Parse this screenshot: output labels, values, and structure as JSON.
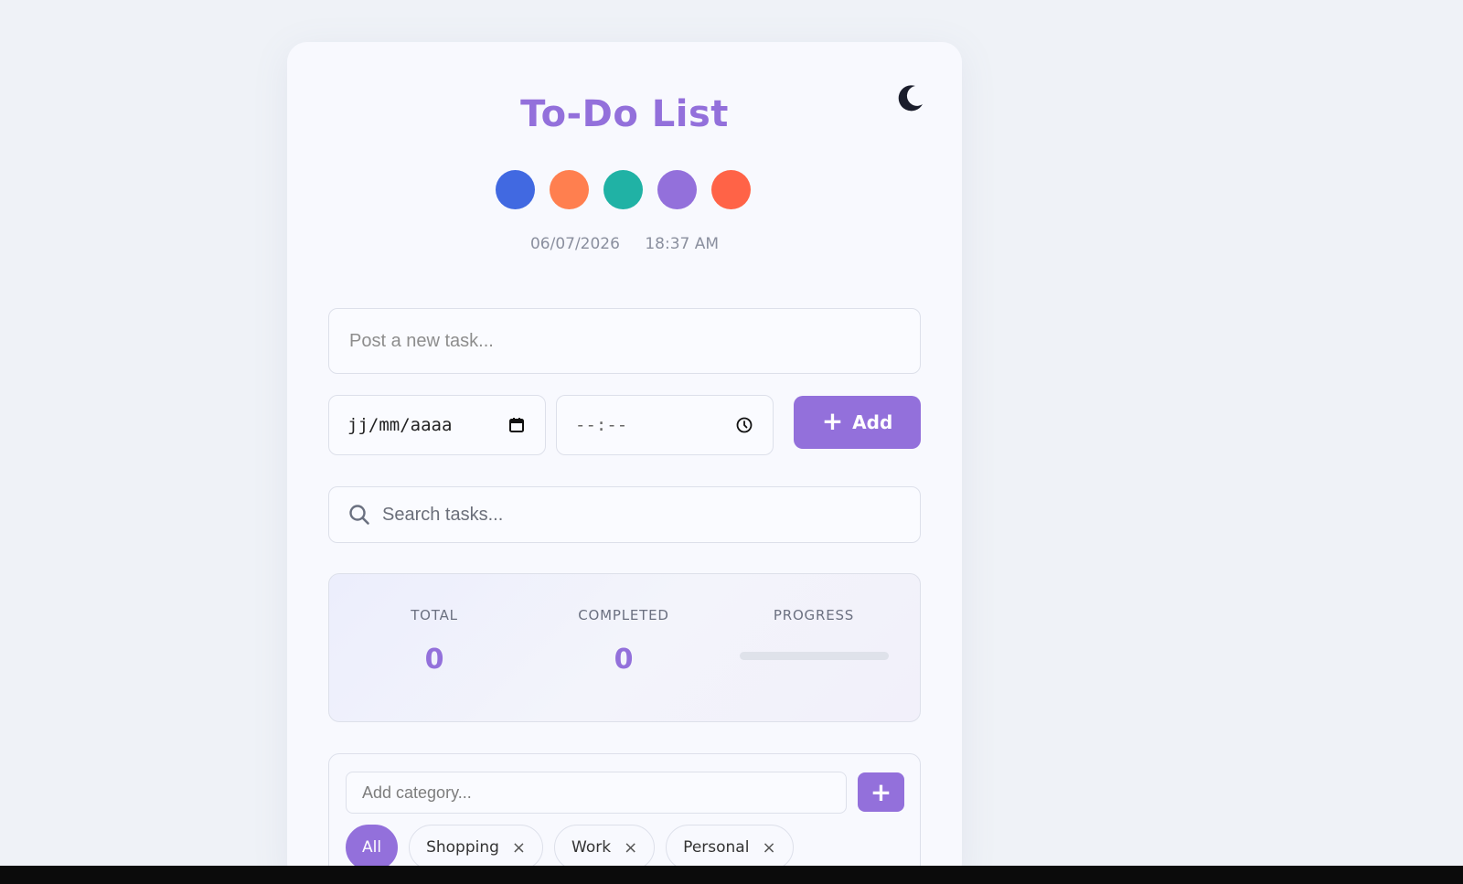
{
  "header": {
    "title": "To-Do List",
    "theme_toggle_icon": "moon-icon",
    "date": "06/07/2026",
    "time": "18:37 AM"
  },
  "color_swatches": [
    {
      "name": "blue",
      "color": "#4169e1"
    },
    {
      "name": "orange",
      "color": "#ff7f4f"
    },
    {
      "name": "teal",
      "color": "#20b2a5"
    },
    {
      "name": "purple",
      "color": "#9370db"
    },
    {
      "name": "red-orange",
      "color": "#ff6347"
    }
  ],
  "task_form": {
    "task_placeholder": "Post a new task...",
    "date_value": "jj/mm/aaaa",
    "time_value": "--:--",
    "add_label": "Add"
  },
  "search": {
    "placeholder": "Search tasks..."
  },
  "stats": {
    "total_label": "TOTAL",
    "total_value": "0",
    "completed_label": "COMPLETED",
    "completed_value": "0",
    "progress_label": "PROGRESS",
    "progress_fraction": 0
  },
  "categories": {
    "input_placeholder": "Add category...",
    "add_label": "+",
    "chips": [
      {
        "label": "All",
        "active": true,
        "removable": false
      },
      {
        "label": "Shopping",
        "active": false,
        "removable": true
      },
      {
        "label": "Work",
        "active": false,
        "removable": true
      },
      {
        "label": "Personal",
        "active": false,
        "removable": true
      }
    ],
    "remove_glyph": "×"
  },
  "colors": {
    "accent": "#9370db",
    "background": "#eff2f7",
    "card": "#f8f9fe"
  }
}
